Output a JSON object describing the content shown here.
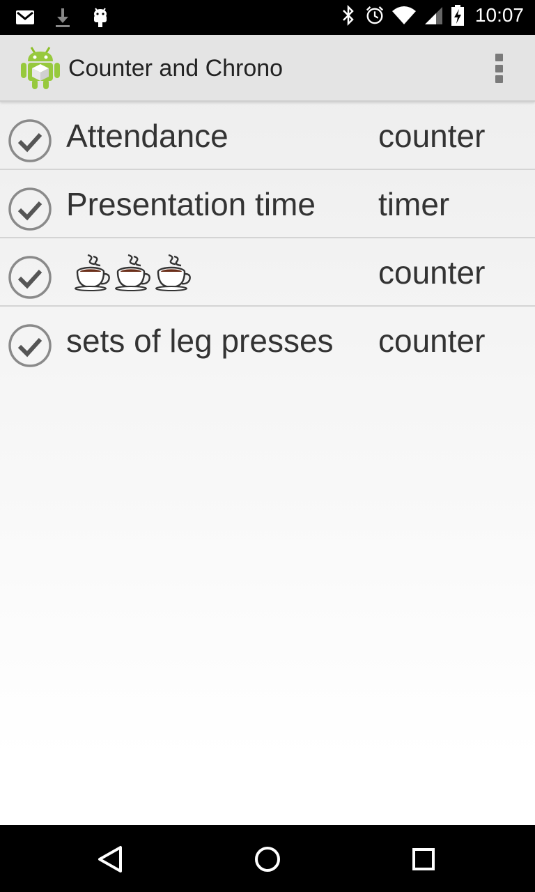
{
  "status_bar": {
    "time": "10:07",
    "left_icons": [
      "gmail-icon",
      "download-icon",
      "android-debug-icon"
    ],
    "right_icons": [
      "bluetooth-icon",
      "alarm-icon",
      "wifi-icon",
      "signal-icon",
      "battery-charging-icon"
    ]
  },
  "action_bar": {
    "title": "Counter and Chrono",
    "app_icon": "android-app-icon",
    "overflow_icon": "overflow-menu-icon"
  },
  "list": {
    "items": [
      {
        "name": "Attendance",
        "type": "counter",
        "checked": true
      },
      {
        "name": "Presentation time",
        "type": "timer",
        "checked": true
      },
      {
        "name": "☕☕☕",
        "type": "counter",
        "checked": true
      },
      {
        "name": "sets of leg presses",
        "type": "counter",
        "checked": true
      }
    ]
  },
  "nav_bar": {
    "buttons": [
      "back-icon",
      "home-icon",
      "recents-icon"
    ]
  },
  "colors": {
    "status_bar": "#000000",
    "action_bar": "#e4e4e4",
    "text": "#333333",
    "divider": "#d4d4d4",
    "check_ring": "#8a8a8a"
  }
}
